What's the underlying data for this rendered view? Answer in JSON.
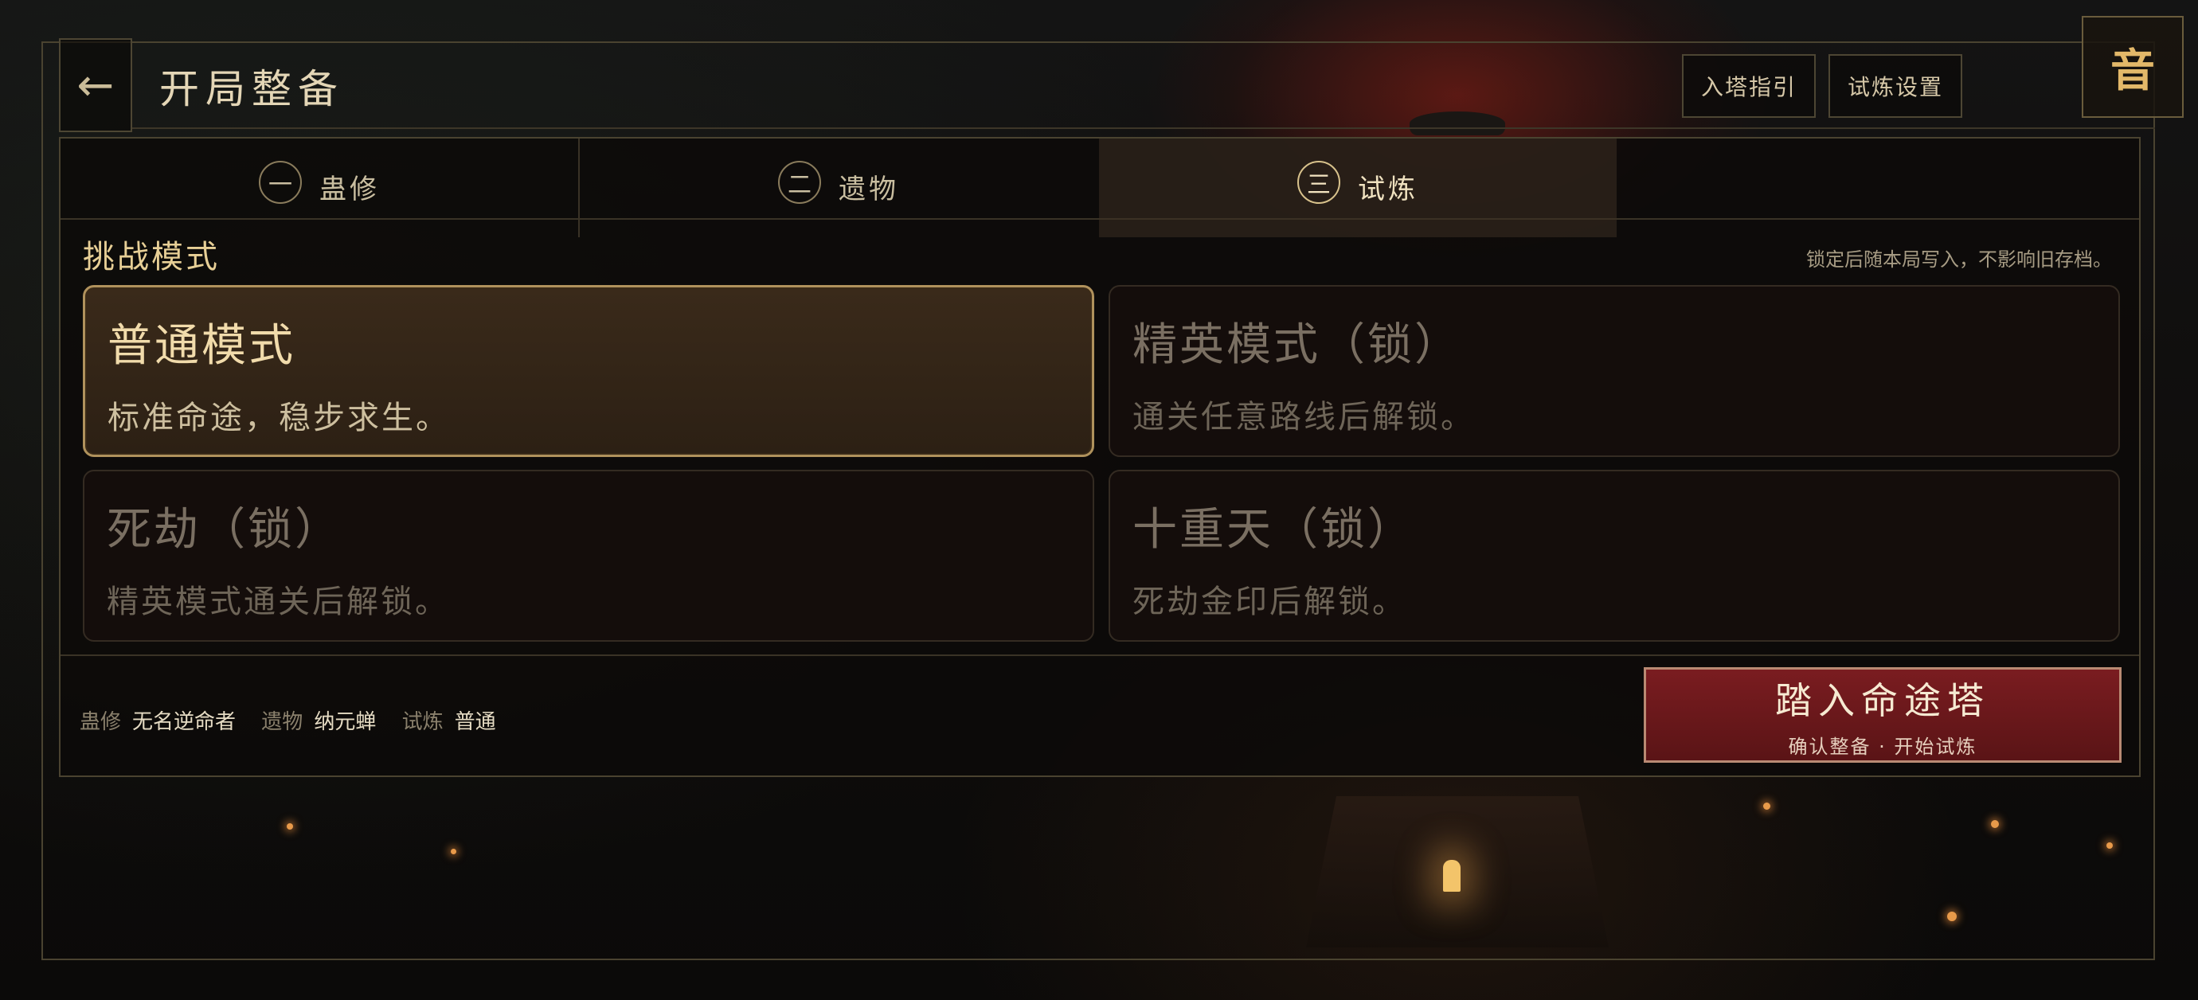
{
  "header": {
    "title": "开局整备",
    "back_icon": "←",
    "guide_label": "入塔指引",
    "settings_label": "试炼设置",
    "sound_label": "音"
  },
  "tabs": [
    {
      "num": "一",
      "label": "蛊修",
      "active": false
    },
    {
      "num": "二",
      "label": "遗物",
      "active": false
    },
    {
      "num": "三",
      "label": "试炼",
      "active": true
    }
  ],
  "section": {
    "title": "挑战模式",
    "note": "锁定后随本局写入，不影响旧存档。"
  },
  "modes": [
    {
      "title": "普通模式",
      "desc": "标准命途，稳步求生。",
      "selected": true,
      "locked": false
    },
    {
      "title": "精英模式（锁）",
      "desc": "通关任意路线后解锁。",
      "selected": false,
      "locked": true
    },
    {
      "title": "死劫（锁）",
      "desc": "精英模式通关后解锁。",
      "selected": false,
      "locked": true
    },
    {
      "title": "十重天（锁）",
      "desc": "死劫金印后解锁。",
      "selected": false,
      "locked": true
    }
  ],
  "summary": {
    "gu_label": "蛊修",
    "gu_value": "无名逆命者",
    "relic_label": "遗物",
    "relic_value": "纳元蝉",
    "trial_label": "试炼",
    "trial_value": "普通"
  },
  "enter": {
    "title": "踏入命途塔",
    "sub": "确认整备 · 开始试炼"
  },
  "colors": {
    "accent_gold": "#e3b869",
    "enter_red": "#7a1c20",
    "selected_border": "#b0925c"
  }
}
